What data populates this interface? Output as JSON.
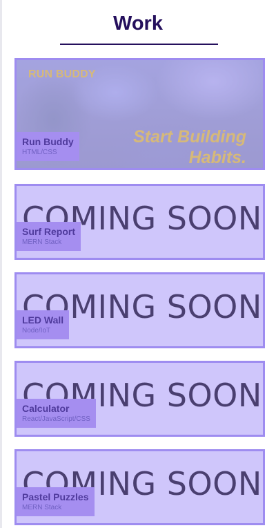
{
  "section": {
    "title": "Work"
  },
  "featured": {
    "brand": "RUN BUDDY",
    "tagline_line1": "Start Building",
    "tagline_line2": "Habits.",
    "title": "Run Buddy",
    "tech": "HTML/CSS"
  },
  "projects": [
    {
      "overlay": "COMING SOON",
      "title": "Surf Report",
      "tech": "MERN Stack"
    },
    {
      "overlay": "COMING SOON",
      "title": "LED Wall",
      "tech": "Node/IoT"
    },
    {
      "overlay": "COMING SOON",
      "title": "Calculator",
      "tech": "React/JavaScript/CSS"
    },
    {
      "overlay": "COMING SOON",
      "title": "Pastel Puzzles",
      "tech": "MERN Stack"
    }
  ],
  "colors": {
    "heading": "#25105d",
    "card_border": "#9e8cf0",
    "card_bg": "#cfc6fb",
    "label_bg": "#a58ef0",
    "label_title": "#4f3a9c",
    "gold_text": "#d6b979"
  }
}
